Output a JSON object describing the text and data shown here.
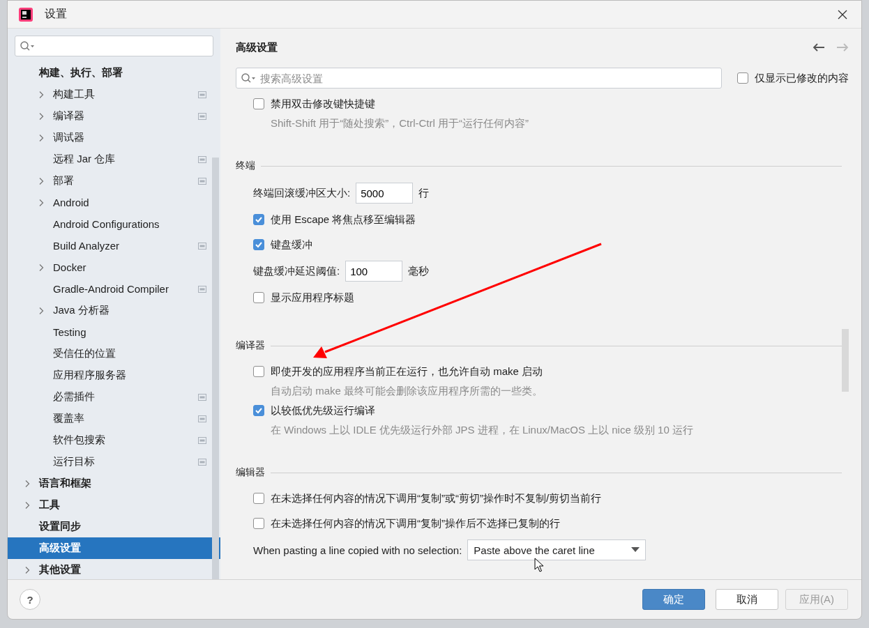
{
  "window": {
    "title": "设置"
  },
  "sidebar": {
    "items": [
      {
        "label": "构建、执行、部署",
        "expandable": false,
        "project_level": false,
        "selected": false,
        "children": [
          {
            "label": "构建工具",
            "expandable": true,
            "project_level": true,
            "selected": false
          },
          {
            "label": "编译器",
            "expandable": true,
            "project_level": true,
            "selected": false
          },
          {
            "label": "调试器",
            "expandable": true,
            "project_level": false,
            "selected": false
          },
          {
            "label": "远程 Jar 仓库",
            "expandable": false,
            "project_level": true,
            "selected": false
          },
          {
            "label": "部署",
            "expandable": true,
            "project_level": true,
            "selected": false
          },
          {
            "label": "Android",
            "expandable": true,
            "project_level": false,
            "selected": false
          },
          {
            "label": "Android Configurations",
            "expandable": false,
            "project_level": false,
            "selected": false
          },
          {
            "label": "Build Analyzer",
            "expandable": false,
            "project_level": true,
            "selected": false
          },
          {
            "label": "Docker",
            "expandable": true,
            "project_level": false,
            "selected": false
          },
          {
            "label": "Gradle-Android Compiler",
            "expandable": false,
            "project_level": true,
            "selected": false
          },
          {
            "label": "Java 分析器",
            "expandable": true,
            "project_level": false,
            "selected": false
          },
          {
            "label": "Testing",
            "expandable": false,
            "project_level": false,
            "selected": false
          },
          {
            "label": "受信任的位置",
            "expandable": false,
            "project_level": false,
            "selected": false
          },
          {
            "label": "应用程序服务器",
            "expandable": false,
            "project_level": false,
            "selected": false
          },
          {
            "label": "必需插件",
            "expandable": false,
            "project_level": true,
            "selected": false
          },
          {
            "label": "覆盖率",
            "expandable": false,
            "project_level": true,
            "selected": false
          },
          {
            "label": "软件包搜索",
            "expandable": false,
            "project_level": true,
            "selected": false
          },
          {
            "label": "运行目标",
            "expandable": false,
            "project_level": true,
            "selected": false
          }
        ]
      },
      {
        "label": "语言和框架",
        "expandable": true,
        "project_level": false,
        "selected": false
      },
      {
        "label": "工具",
        "expandable": true,
        "project_level": false,
        "selected": false
      },
      {
        "label": "设置同步",
        "expandable": false,
        "project_level": false,
        "selected": false
      },
      {
        "label": "高级设置",
        "expandable": false,
        "project_level": false,
        "selected": true
      },
      {
        "label": "其他设置",
        "expandable": true,
        "project_level": false,
        "selected": false
      }
    ]
  },
  "main": {
    "title": "高级设置",
    "nav": {
      "back_disabled": false,
      "forward_disabled": true
    },
    "search": {
      "placeholder": "搜索高级设置"
    },
    "modified_only": {
      "label": "仅显示已修改的内容",
      "checked": false
    },
    "sections": [
      {
        "items": [
          {
            "kind": "checkbox",
            "label": "禁用双击修改键快捷键",
            "checked": false,
            "hint": "Shift-Shift 用于“随处搜索”，Ctrl-Ctrl 用于“运行任何内容”"
          }
        ]
      },
      {
        "title": "终端",
        "items": [
          {
            "kind": "number",
            "label": "终端回滚缓冲区大小:",
            "value": "5000",
            "unit": "行"
          },
          {
            "kind": "checkbox",
            "label": "使用 Escape 将焦点移至编辑器",
            "checked": true
          },
          {
            "kind": "checkbox",
            "label": "键盘缓冲",
            "checked": true
          },
          {
            "kind": "number",
            "label": "键盘缓冲延迟阈值:",
            "value": "100",
            "unit": "毫秒"
          },
          {
            "kind": "checkbox",
            "label": "显示应用程序标题",
            "checked": false
          }
        ]
      },
      {
        "title": "编译器",
        "items": [
          {
            "kind": "checkbox",
            "label": "即使开发的应用程序当前正在运行，也允许自动 make 启动",
            "checked": false,
            "hint": "自动启动 make 最终可能会删除该应用程序所需的一些类。"
          },
          {
            "kind": "checkbox",
            "label": "以较低优先级运行编译",
            "checked": true,
            "hint": "在 Windows 上以 IDLE 优先级运行外部 JPS 进程，在 Linux/MacOS 上以 nice 级别 10 运行"
          }
        ]
      },
      {
        "title": "编辑器",
        "items": [
          {
            "kind": "checkbox",
            "label": "在未选择任何内容的情况下调用“复制”或“剪切”操作时不复制/剪切当前行",
            "checked": false
          },
          {
            "kind": "checkbox",
            "label": "在未选择任何内容的情况下调用“复制”操作后不选择已复制的行",
            "checked": false
          },
          {
            "kind": "dropdown",
            "label": "When pasting a line copied with no selection:",
            "value": "Paste above the caret line"
          }
        ]
      }
    ]
  },
  "annotation": {
    "kind": "arrow"
  },
  "help_button": {
    "label": "?"
  },
  "buttons": [
    {
      "label": "确定",
      "kind": "primary",
      "disabled": false
    },
    {
      "label": "取消",
      "kind": "normal",
      "disabled": false
    },
    {
      "label": "应用(A)",
      "kind": "normal",
      "disabled": true
    }
  ]
}
